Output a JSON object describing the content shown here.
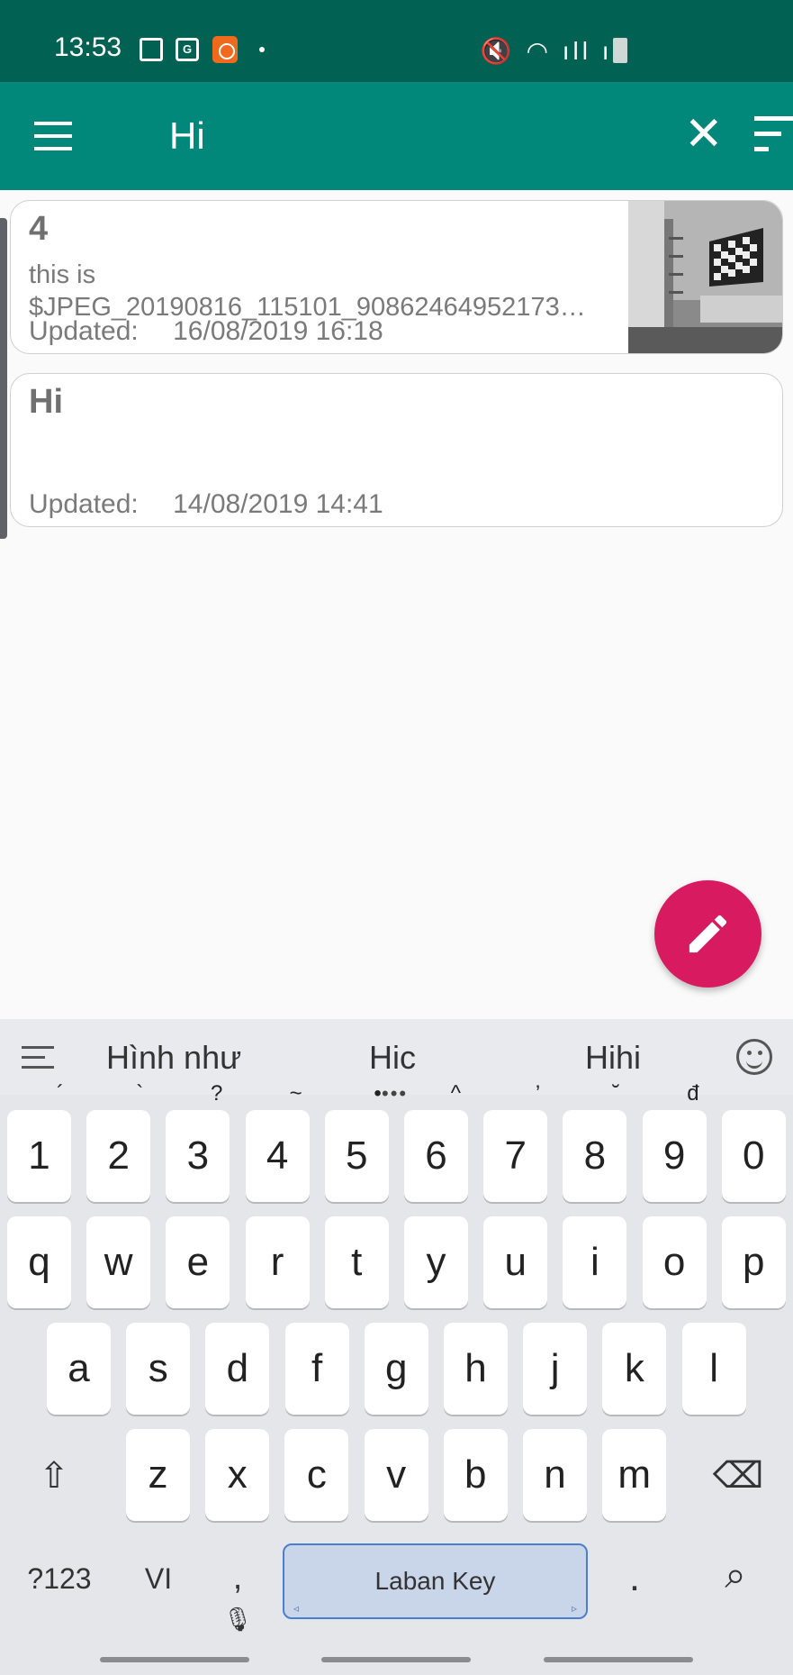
{
  "status_bar": {
    "time": "13:53",
    "maps_badge": "G",
    "right_icons": "🔇 ◠ ıll ıll",
    "icons": [
      "gallery-icon",
      "maps-icon",
      "recorder-icon",
      "mute-icon",
      "wifi-icon",
      "signal-icon",
      "battery-icon"
    ]
  },
  "toolbar": {
    "search_query": "Hi",
    "close_glyph": "✕"
  },
  "notes": [
    {
      "title": "4",
      "body_line1": "this is",
      "body_line2": "$JPEG_20190816_115101_90862464952173…",
      "updated_label": "Updated:",
      "updated_value": "16/08/2019 16:18"
    },
    {
      "title": "Hi",
      "updated_label": "Updated:",
      "updated_value": "14/08/2019 14:41"
    }
  ],
  "keyboard": {
    "suggestions": [
      "Hình như",
      "Hic",
      "Hihi"
    ],
    "sug_more": "•••",
    "number_row": [
      "1",
      "2",
      "3",
      "4",
      "5",
      "6",
      "7",
      "8",
      "9",
      "0"
    ],
    "number_hints": [
      "´",
      "`",
      "?",
      "~",
      "•",
      "^",
      "’",
      "˘",
      "đ",
      ""
    ],
    "row1": [
      "q",
      "w",
      "e",
      "r",
      "t",
      "y",
      "u",
      "i",
      "o",
      "p"
    ],
    "row2": [
      "a",
      "s",
      "d",
      "f",
      "g",
      "h",
      "j",
      "k",
      "l"
    ],
    "row3": [
      "z",
      "x",
      "c",
      "v",
      "b",
      "n",
      "m"
    ],
    "shift_glyph": "⇧",
    "backspace_glyph": "⌫",
    "symbols_label": "?123",
    "lang_label": "VI",
    "comma_label": ",",
    "space_label": "Laban Key",
    "space_left": "◃",
    "space_right": "▹",
    "period_label": ".",
    "search_glyph": "⌕"
  },
  "colors": {
    "status_bar": "#016152",
    "toolbar": "#02887a",
    "fab": "#d81b60"
  }
}
